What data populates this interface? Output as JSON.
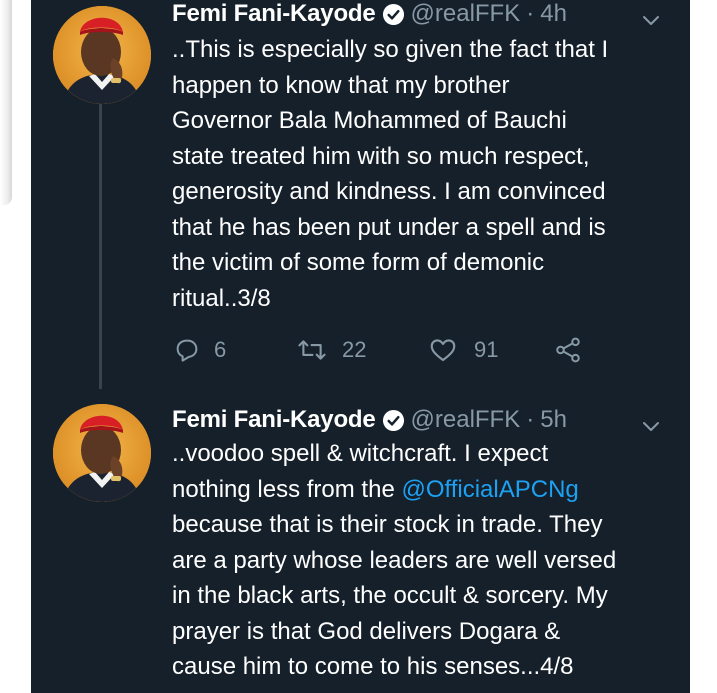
{
  "tweets": [
    {
      "author_name": "Femi Fani-Kayode",
      "handle": "@realFFK",
      "separator": "·",
      "time": "4h",
      "text": "..This is especially so given the fact that I\nhappen to know that my brother\nGovernor Bala Mohammed of Bauchi\nstate treated him with so much respect,\ngenerosity and kindness. I am convinced\nthat he  has been put under a spell and is\nthe victim of some form of demonic\nritual..3/8",
      "reply_count": "6",
      "retweet_count": "22",
      "like_count": "91"
    },
    {
      "author_name": "Femi Fani-Kayode",
      "handle": "@realFFK",
      "separator": "·",
      "time": "5h",
      "text_line1": "..voodoo spell & witchcraft. I expect",
      "text_before_mention": "nothing less from the ",
      "mention": "@OfficialAPCNg",
      "text_after_mention": "because that is their stock in trade. They\nare a party whose leaders are well versed\nin the black arts, the occult & sorcery. My\nprayer is that God delivers Dogara &\ncause him to come to his senses...4/8"
    }
  ],
  "icons": {
    "verified": "verified-badge-icon",
    "menu": "chevron-down-icon",
    "reply": "reply-icon",
    "retweet": "retweet-icon",
    "like": "heart-icon",
    "share": "share-icon"
  },
  "colors": {
    "background": "#15202b",
    "text": "#ffffff",
    "secondary_text": "#8899a6",
    "link": "#1da1f2",
    "thread_line": "#38444d"
  }
}
